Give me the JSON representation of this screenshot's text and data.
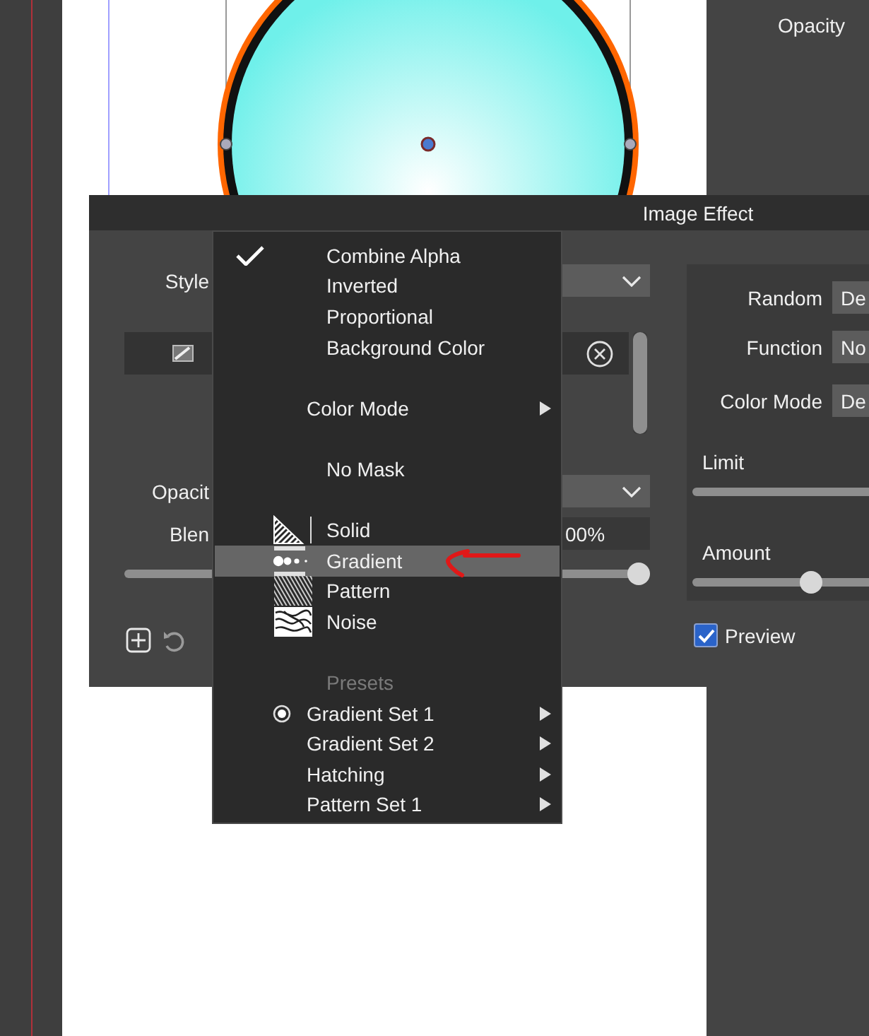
{
  "side_panel": {
    "label": "Opacity"
  },
  "dialog": {
    "title": "Image Effect",
    "style_label": "Style",
    "opacity_label": "Opacit",
    "blend_label": "Blen",
    "blend_value": "00%",
    "blend_slider": {
      "level": 1
    },
    "settings": [
      {
        "label": "Random",
        "value": "De"
      },
      {
        "label": "Function",
        "value": "No"
      },
      {
        "label": "Color Mode",
        "value": "De"
      }
    ],
    "limit": {
      "label": "Limit"
    },
    "amount": {
      "label": "Amount",
      "level": 0.29
    },
    "preview": {
      "label": "Preview",
      "checked": true
    }
  },
  "menu": {
    "sections": [
      {
        "items": [
          {
            "kind": "toggle",
            "label": "Combine Alpha",
            "checked": true
          },
          {
            "kind": "toggle",
            "label": "Inverted",
            "checked": false
          },
          {
            "kind": "toggle",
            "label": "Proportional",
            "checked": false
          },
          {
            "kind": "toggle",
            "label": "Background Color",
            "checked": false
          }
        ]
      },
      {
        "items": [
          {
            "kind": "submenu",
            "label": "Color Mode"
          }
        ]
      },
      {
        "items": [
          {
            "kind": "option",
            "label": "No Mask"
          }
        ]
      },
      {
        "items": [
          {
            "kind": "mask",
            "label": "Solid",
            "selected": false
          },
          {
            "kind": "mask",
            "label": "Gradient",
            "selected": true
          },
          {
            "kind": "mask",
            "label": "Pattern",
            "selected": false
          },
          {
            "kind": "mask",
            "label": "Noise",
            "selected": false
          }
        ]
      },
      {
        "items": [
          {
            "kind": "header",
            "label": "Presets"
          },
          {
            "kind": "preset",
            "label": "Gradient Set 1",
            "selected": true
          },
          {
            "kind": "preset",
            "label": "Gradient Set 2",
            "selected": false
          },
          {
            "kind": "preset",
            "label": "Hatching",
            "selected": false
          },
          {
            "kind": "preset",
            "label": "Pattern Set 1",
            "selected": false
          }
        ]
      }
    ]
  }
}
